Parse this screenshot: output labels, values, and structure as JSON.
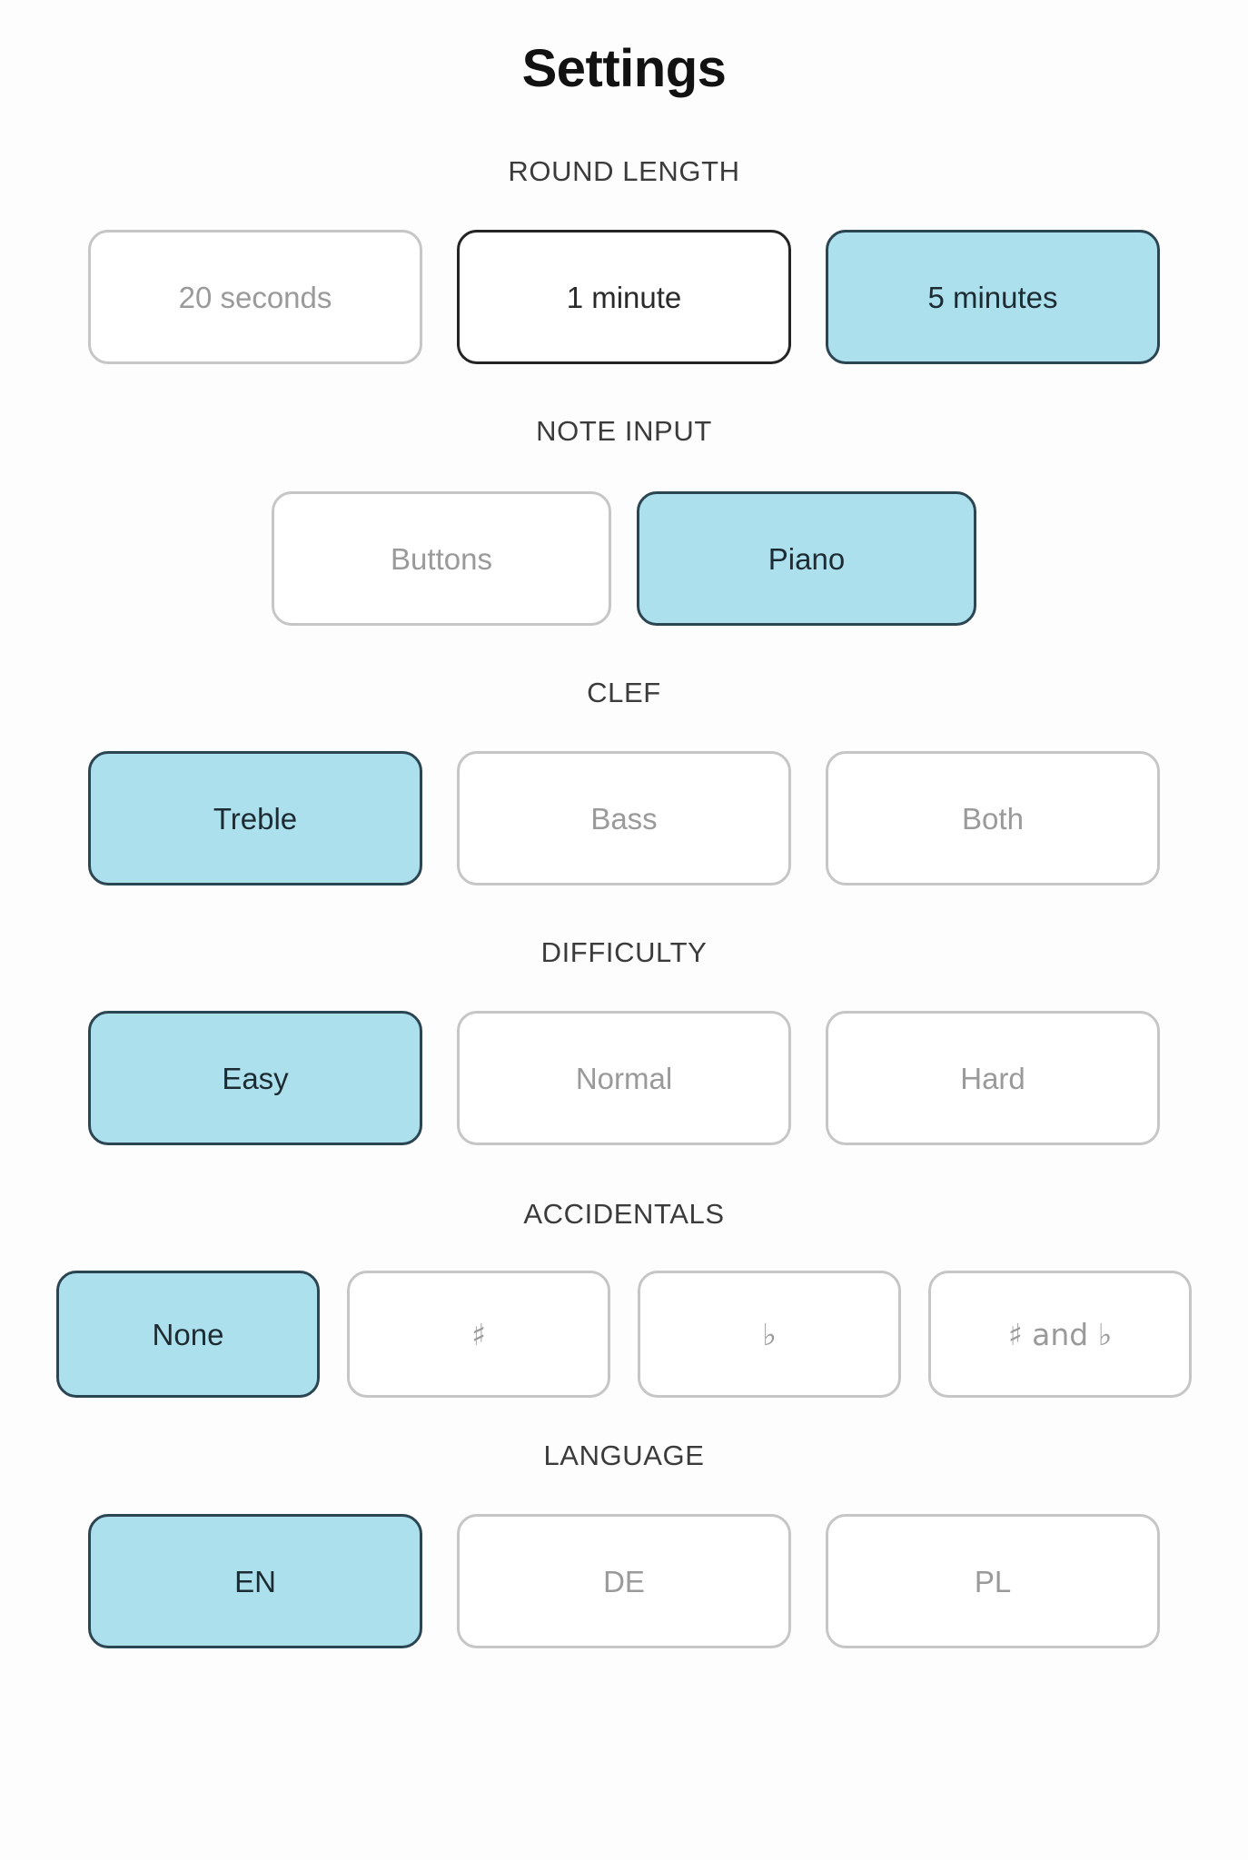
{
  "header": {
    "title": "Settings"
  },
  "colors": {
    "selected_fill": "#ade0ed",
    "selected_border": "#2b4552",
    "selected_text": "#1d2b33",
    "focused_border": "#242424",
    "default_border": "#c6c6c6",
    "default_text": "#9a9a9a",
    "label_text": "#3b3b3b",
    "title_text": "#121212",
    "background": "#fdfdfd"
  },
  "sections": [
    {
      "id": "round-length",
      "label": "ROUND LENGTH",
      "options": [
        {
          "label": "20 seconds",
          "state": "default"
        },
        {
          "label": "1 minute",
          "state": "focused"
        },
        {
          "label": "5 minutes",
          "state": "selected"
        }
      ]
    },
    {
      "id": "note-input",
      "label": "NOTE INPUT",
      "options": [
        {
          "label": "Buttons",
          "state": "default"
        },
        {
          "label": "Piano",
          "state": "selected"
        }
      ]
    },
    {
      "id": "clef",
      "label": "CLEF",
      "options": [
        {
          "label": "Treble",
          "state": "selected"
        },
        {
          "label": "Bass",
          "state": "default"
        },
        {
          "label": "Both",
          "state": "default"
        }
      ]
    },
    {
      "id": "difficulty",
      "label": "DIFFICULTY",
      "options": [
        {
          "label": "Easy",
          "state": "selected"
        },
        {
          "label": "Normal",
          "state": "default"
        },
        {
          "label": "Hard",
          "state": "default"
        }
      ]
    },
    {
      "id": "accidentals",
      "label": "ACCIDENTALS",
      "options": [
        {
          "label": "None",
          "state": "selected"
        },
        {
          "label": "♯",
          "state": "default"
        },
        {
          "label": "♭",
          "state": "default"
        },
        {
          "label": "♯ and ♭",
          "state": "default"
        }
      ]
    },
    {
      "id": "language",
      "label": "LANGUAGE",
      "options": [
        {
          "label": "EN",
          "state": "selected"
        },
        {
          "label": "DE",
          "state": "default"
        },
        {
          "label": "PL",
          "state": "default"
        }
      ]
    }
  ]
}
